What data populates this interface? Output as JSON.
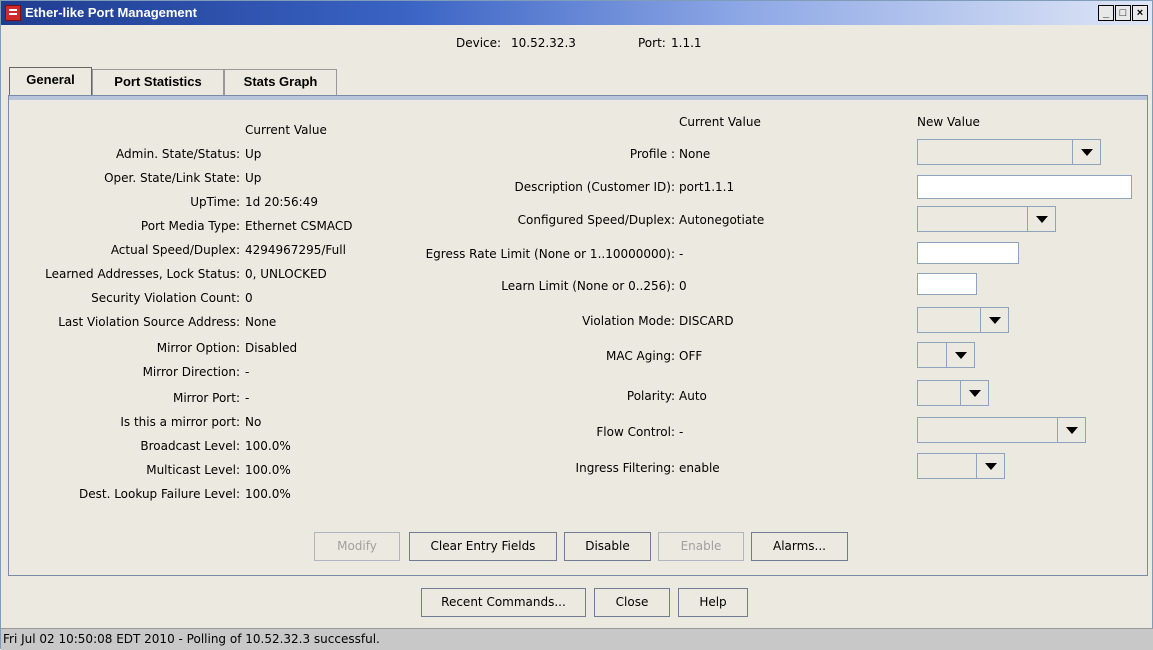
{
  "window": {
    "title": "Ether-like Port Management",
    "min_label": "_",
    "max_label": "□",
    "close_label": "×"
  },
  "device": {
    "device_label": "Device:",
    "device_value": "10.52.32.3",
    "port_label": "Port:",
    "port_value": "1.1.1"
  },
  "tabs": [
    {
      "label": "General",
      "active": true
    },
    {
      "label": "Port Statistics",
      "active": false
    },
    {
      "label": "Stats Graph",
      "active": false
    }
  ],
  "left": {
    "header": "Current Value",
    "rows": [
      {
        "label": "Admin. State/Status:",
        "value": "Up"
      },
      {
        "label": "Oper. State/Link State:",
        "value": "Up"
      },
      {
        "label": "UpTime:",
        "value": "1d 20:56:49"
      },
      {
        "label": "Port Media Type:",
        "value": "Ethernet CSMACD"
      },
      {
        "label": "Actual Speed/Duplex:",
        "value": "4294967295/Full"
      },
      {
        "label": "Learned Addresses, Lock Status:",
        "value": "0, UNLOCKED"
      },
      {
        "label": "Security Violation Count:",
        "value": "0"
      },
      {
        "label": "Last Violation Source Address:",
        "value": "None"
      },
      {
        "label": "Mirror Option:",
        "value": "Disabled"
      },
      {
        "label": "Mirror Direction:",
        "value": "-"
      },
      {
        "label": "Mirror Port:",
        "value": "-"
      },
      {
        "label": "Is this a mirror port:",
        "value": "No"
      },
      {
        "label": "Broadcast Level:",
        "value": "100.0%"
      },
      {
        "label": "Multicast Level:",
        "value": "100.0%"
      },
      {
        "label": "Dest. Lookup Failure Level:",
        "value": "100.0%"
      }
    ]
  },
  "right": {
    "current_header": "Current Value",
    "new_header": "New Value",
    "rows": [
      {
        "label": "Profile :",
        "value": "None"
      },
      {
        "label": "Description (Customer ID):",
        "value": "port1.1.1"
      },
      {
        "label": "Configured Speed/Duplex:",
        "value": "Autonegotiate"
      },
      {
        "label": "Egress Rate Limit (None or 1..10000000):",
        "value": "-"
      },
      {
        "label": "Learn Limit (None or 0..256):",
        "value": "0"
      },
      {
        "label": "Violation Mode:",
        "value": "DISCARD"
      },
      {
        "label": "MAC Aging:",
        "value": "OFF"
      },
      {
        "label": "Polarity:",
        "value": "Auto"
      },
      {
        "label": "Flow Control:",
        "value": "-"
      },
      {
        "label": "Ingress Filtering:",
        "value": "enable"
      }
    ]
  },
  "panel_buttons": {
    "modify": "Modify",
    "clear": "Clear Entry Fields",
    "disable": "Disable",
    "enable": "Enable",
    "alarms": "Alarms..."
  },
  "bottom_buttons": {
    "recent": "Recent Commands...",
    "close": "Close",
    "help": "Help"
  },
  "status": {
    "text": "Fri Jul 02 10:50:08 EDT 2010 - Polling of 10.52.32.3 successful."
  }
}
